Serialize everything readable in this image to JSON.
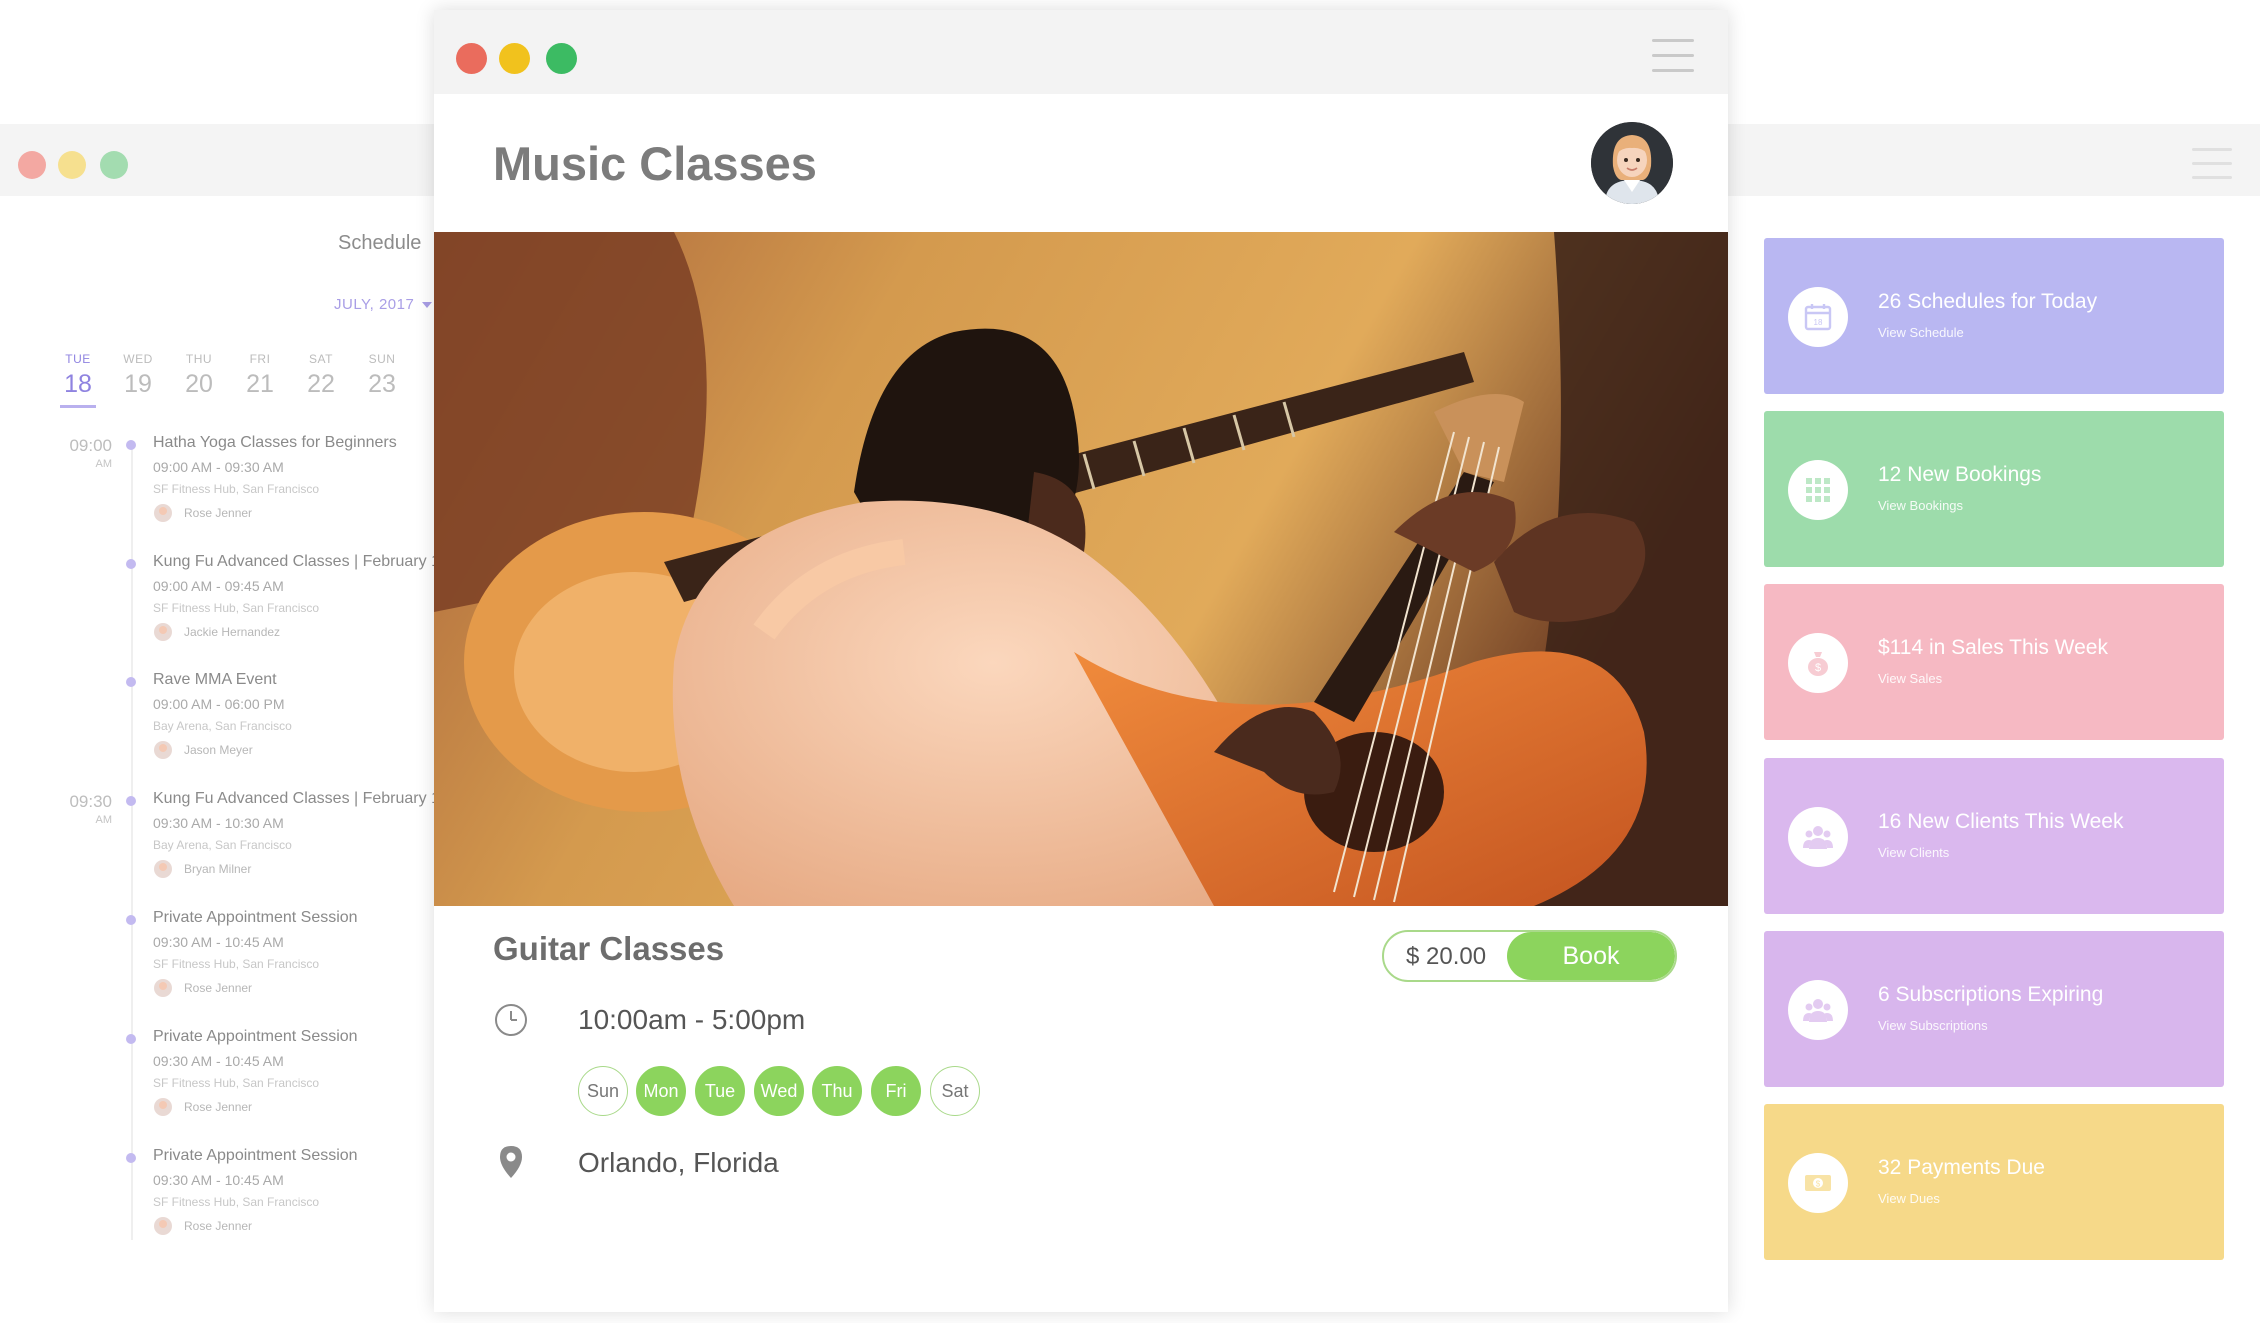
{
  "back_window": {
    "schedule": {
      "title": "Schedule",
      "month": "JULY, 2017",
      "days": [
        {
          "name": "TUE",
          "num": "18",
          "active": true
        },
        {
          "name": "WED",
          "num": "19"
        },
        {
          "name": "THU",
          "num": "20"
        },
        {
          "name": "FRI",
          "num": "21"
        },
        {
          "name": "SAT",
          "num": "22"
        },
        {
          "name": "SUN",
          "num": "23"
        }
      ],
      "time_slots": [
        {
          "time": "09:00",
          "ampm": "AM"
        },
        {
          "time": "09:30",
          "ampm": "AM"
        }
      ],
      "events": [
        {
          "title": "Hatha Yoga Classes for Beginners",
          "time": "09:00 AM - 09:30 AM",
          "location": "SF Fitness Hub, San Francisco",
          "person": "Rose Jenner"
        },
        {
          "title": "Kung Fu Advanced Classes | February 1",
          "time": "09:00 AM - 09:45 AM",
          "location": "SF Fitness Hub, San Francisco",
          "person": "Jackie Hernandez"
        },
        {
          "title": "Rave MMA Event",
          "time": "09:00 AM - 06:00 PM",
          "location": "Bay Arena, San Francisco",
          "person": "Jason Meyer"
        },
        {
          "title": "Kung Fu Advanced Classes | February 1",
          "time": "09:30 AM - 10:30 AM",
          "location": "Bay Arena, San Francisco",
          "person": "Bryan Milner"
        },
        {
          "title": "Private Appointment Session",
          "time": "09:30 AM - 10:45 AM",
          "location": "SF Fitness Hub, San Francisco",
          "person": "Rose Jenner"
        },
        {
          "title": "Private Appointment Session",
          "time": "09:30 AM - 10:45 AM",
          "location": "SF Fitness Hub, San Francisco",
          "person": "Rose Jenner"
        },
        {
          "title": "Private Appointment Session",
          "time": "09:30 AM - 10:45 AM",
          "location": "SF Fitness Hub, San Francisco",
          "person": "Rose Jenner"
        }
      ]
    },
    "cards": [
      {
        "title": "26 Schedules for Today",
        "link": "View Schedule",
        "color": "#b9b7f2",
        "icon": "calendar-icon"
      },
      {
        "title": "12 New Bookings",
        "link": "View Bookings",
        "color": "#9ddcab",
        "icon": "grid-icon"
      },
      {
        "title": "$114 in Sales This Week",
        "link": "View Sales",
        "color": "#f6b9c3",
        "icon": "money-bag-icon"
      },
      {
        "title": "16 New Clients This Week",
        "link": "View Clients",
        "color": "#dab8ee",
        "icon": "users-icon"
      },
      {
        "title": "6 Subscriptions Expiring",
        "link": "View Subscriptions",
        "color": "#d8b6ed",
        "icon": "users-icon"
      },
      {
        "title": "32 Payments Due",
        "link": "View Dues",
        "color": "#f6d989",
        "icon": "cash-icon"
      }
    ]
  },
  "main": {
    "title": "Music Classes",
    "class": {
      "name": "Guitar Classes",
      "price": "$ 20.00",
      "book_label": "Book",
      "time_range": "10:00am - 5:00pm",
      "days": [
        {
          "label": "Sun",
          "on": false
        },
        {
          "label": "Mon",
          "on": true
        },
        {
          "label": "Tue",
          "on": true
        },
        {
          "label": "Wed",
          "on": true
        },
        {
          "label": "Thu",
          "on": true
        },
        {
          "label": "Fri",
          "on": true
        },
        {
          "label": "Sat",
          "on": false
        }
      ],
      "location": "Orlando, Florida"
    },
    "accent_color": "#8cd45d"
  }
}
